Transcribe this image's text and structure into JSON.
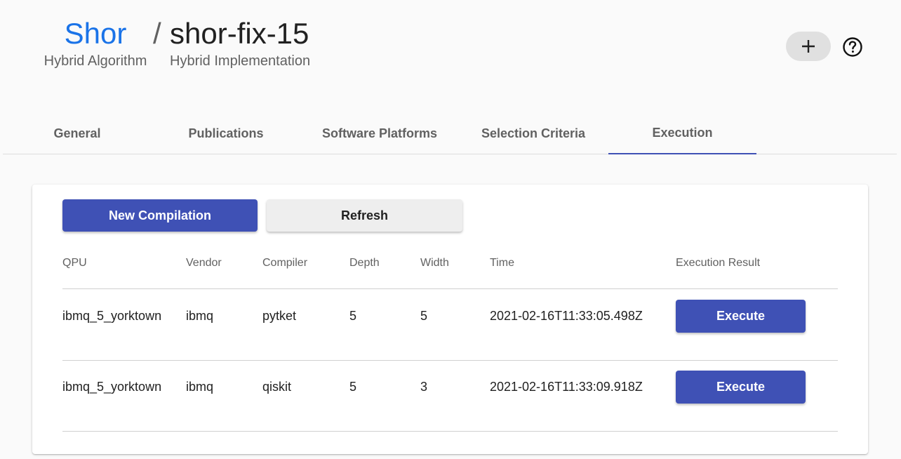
{
  "breadcrumb": {
    "algorithm_title": "Shor",
    "algorithm_subtitle": "Hybrid Algorithm",
    "separator": "/",
    "implementation_title": "shor-fix-15",
    "implementation_subtitle": "Hybrid Implementation"
  },
  "header_actions": {
    "add_icon": "plus-icon",
    "help_icon": "help-circle-icon"
  },
  "tabs": [
    {
      "label": "General",
      "active": false
    },
    {
      "label": "Publications",
      "active": false
    },
    {
      "label": "Software Platforms",
      "active": false
    },
    {
      "label": "Selection Criteria",
      "active": false
    },
    {
      "label": "Execution",
      "active": true
    }
  ],
  "toolbar": {
    "new_compilation_label": "New Compilation",
    "refresh_label": "Refresh"
  },
  "table": {
    "columns": [
      "QPU",
      "Vendor",
      "Compiler",
      "Depth",
      "Width",
      "Time",
      "Execution Result"
    ],
    "rows": [
      {
        "qpu": "ibmq_5_yorktown",
        "vendor": "ibmq",
        "compiler": "pytket",
        "depth": "5",
        "width": "5",
        "time": "2021-02-16T11:33:05.498Z",
        "action": "Execute"
      },
      {
        "qpu": "ibmq_5_yorktown",
        "vendor": "ibmq",
        "compiler": "qiskit",
        "depth": "5",
        "width": "3",
        "time": "2021-02-16T11:33:09.918Z",
        "action": "Execute"
      }
    ]
  },
  "colors": {
    "accent": "#3f51b5",
    "link": "#1a73e8"
  }
}
